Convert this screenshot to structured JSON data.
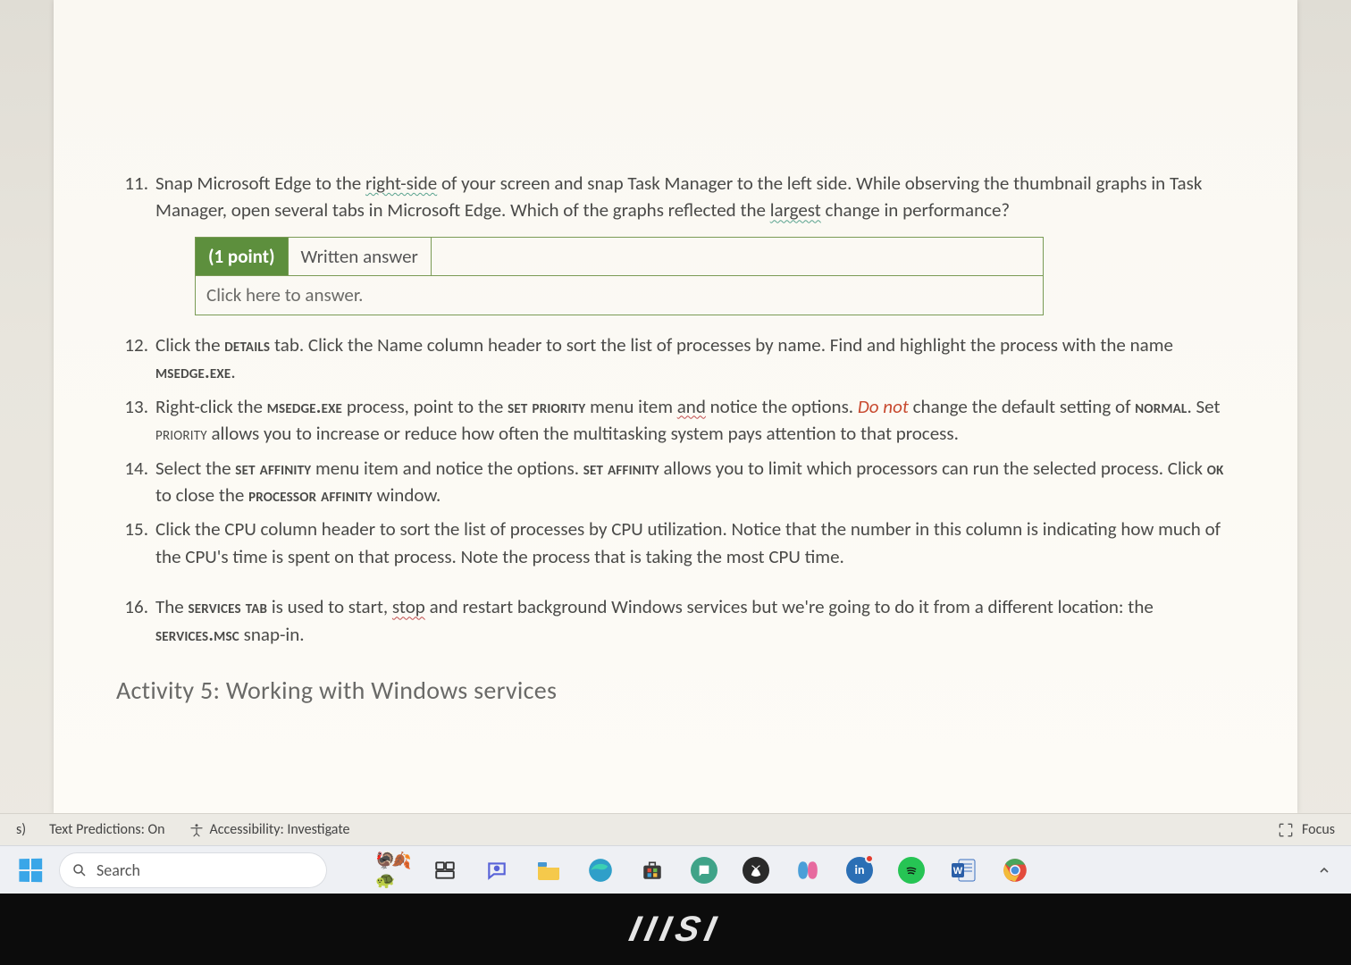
{
  "questions": {
    "q11": {
      "num": "11.",
      "line1_a": "Snap Microsoft Edge to the ",
      "rightside": "right-side",
      "line1_b": " of your screen and snap Task Manager to the left side.",
      "line2": "While observing the thumbnail graphs in Task Manager, open several tabs in Microsoft Edge.",
      "line3_a": "Which of the graphs reflected the ",
      "largest": "largest",
      "line3_b": " change in performance?"
    },
    "answerbox": {
      "points": "(1 point)",
      "type": "Written answer",
      "placeholder": "Click here to answer."
    },
    "q12": {
      "num": "12.",
      "a": "Click the ",
      "details": "details",
      "b": " tab.  Click the Name column header to sort the list of processes by name.  Find and highlight the process with the name ",
      "msedge": "msedge.exe",
      "c": "."
    },
    "q13": {
      "num": "13.",
      "a": "Right-click the ",
      "msedge": "msedge.exe",
      "b": " process, point to the ",
      "setpri": "set priority",
      "c": " menu item ",
      "and": "and",
      "d": " notice the options.  ",
      "donot": "Do not",
      "e": " change the default setting of ",
      "normal": "normal",
      "f": ".  Set ",
      "priority": "priority",
      "g": " allows you to increase or reduce how often the multitasking system pays attention to that process."
    },
    "q14": {
      "num": "14.",
      "a": "Select the ",
      "setaff": "set affinity",
      "b": " menu item and notice the options.  ",
      "setaff2": "set affinity",
      "c": " allows you to limit which processors can run the selected process.  Click ",
      "ok": "ok",
      "d": " to close the ",
      "procaff": "processor affinity",
      "e": " window."
    },
    "q15": {
      "num": "15.",
      "text": "Click the CPU column header to sort the list of processes by CPU utilization.  Notice that the number in this column is indicating how much of the CPU's time is spent on that process.  Note the process that is taking the most CPU time."
    },
    "q16": {
      "num": "16.",
      "a": "The ",
      "svcstab": "services tab",
      "b": " is used to start, ",
      "stop": "stop",
      "c": " and restart background Windows services but we're going to do it from a different location: the ",
      "svcsmsc": "services.msc",
      "d": " snap-in."
    }
  },
  "activity_heading": "Activity 5: Working with Windows services",
  "statusbar": {
    "left_suffix": "s)",
    "predictions": "Text Predictions: On",
    "accessibility": "Accessibility: Investigate",
    "focus": "Focus"
  },
  "taskbar": {
    "search_placeholder": "Search",
    "emoji_cluster": "🦃🍂🐢"
  },
  "brand": "IIISI"
}
